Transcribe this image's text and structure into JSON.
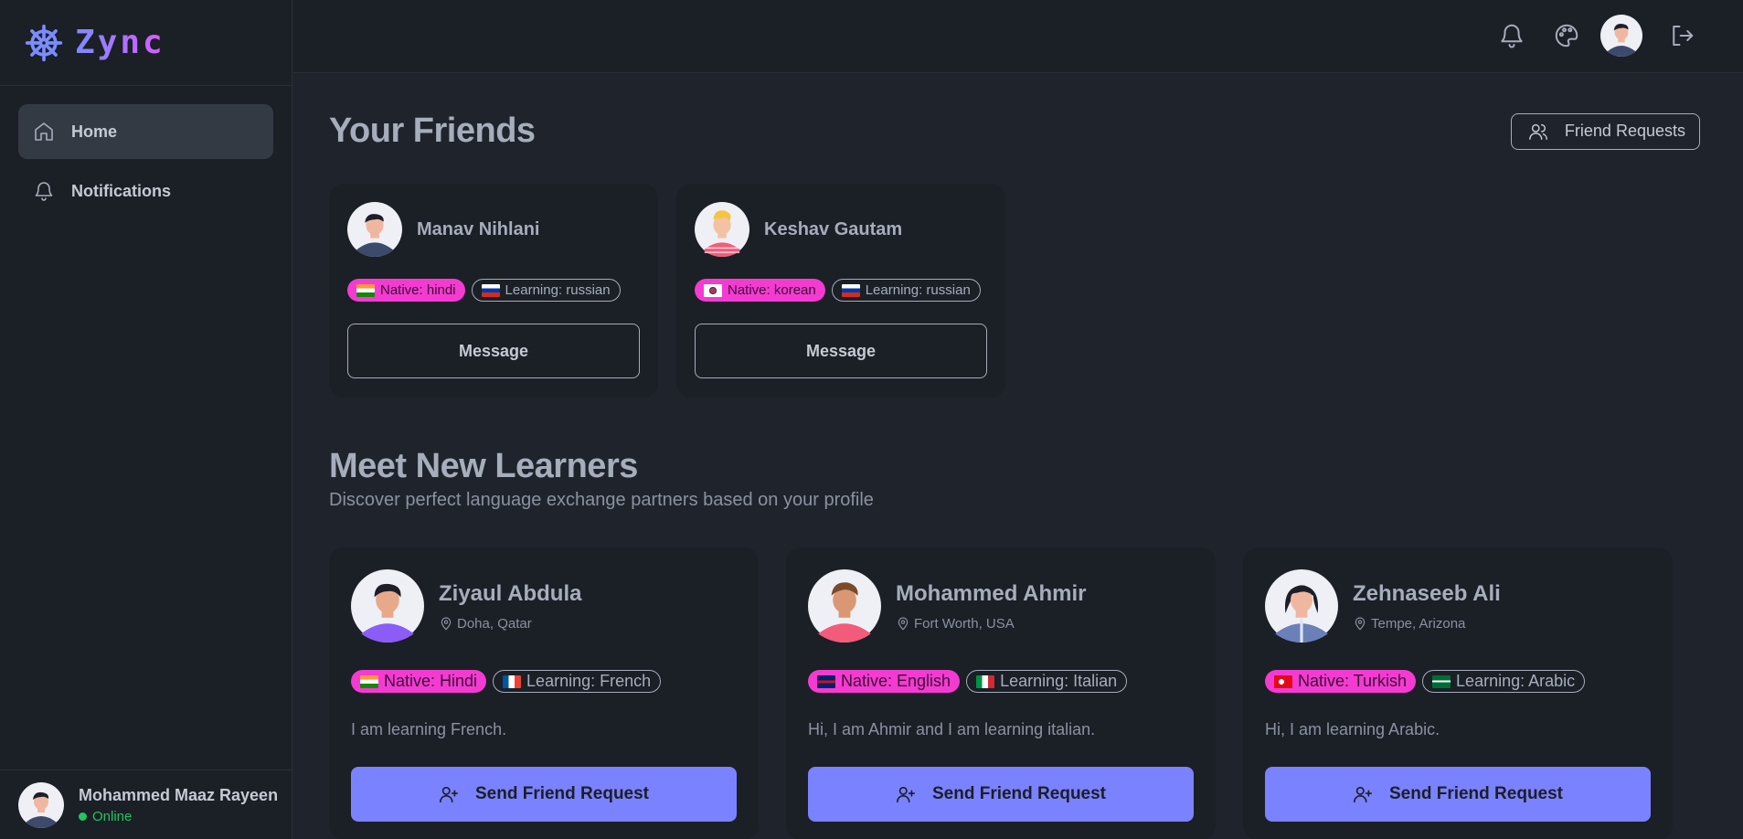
{
  "app": {
    "name": "Zync"
  },
  "sidebar": {
    "items": [
      {
        "label": "Home",
        "icon": "home-icon",
        "active": true
      },
      {
        "label": "Notifications",
        "icon": "bell-icon",
        "active": false
      }
    ],
    "user": {
      "name": "Mohammed Maaz Rayeen",
      "status": "Online"
    }
  },
  "topbar": {
    "icons": [
      "bell-icon",
      "palette-icon",
      "avatar",
      "logout-icon"
    ]
  },
  "friends_section": {
    "title": "Your Friends",
    "requests_label": "Friend Requests",
    "friends": [
      {
        "name": "Manav Nihlani",
        "native": "Native: hindi",
        "learning": "Learning: russian",
        "native_flag": "india",
        "learning_flag": "russia",
        "button": "Message"
      },
      {
        "name": "Keshav Gautam",
        "native": "Native: korean",
        "learning": "Learning: russian",
        "native_flag": "korea",
        "learning_flag": "russia",
        "button": "Message"
      }
    ]
  },
  "learners_section": {
    "title": "Meet New Learners",
    "subtitle": "Discover perfect language exchange partners based on your profile",
    "learners": [
      {
        "name": "Ziyaul Abdula",
        "location": "Doha, Qatar",
        "native": "Native: Hindi",
        "learning": "Learning: French",
        "native_flag": "india",
        "learning_flag": "france",
        "bio": "I am learning French.",
        "button": "Send Friend Request"
      },
      {
        "name": "Mohammed Ahmir",
        "location": "Fort Worth, USA",
        "native": "Native: English",
        "learning": "Learning: Italian",
        "native_flag": "uk",
        "learning_flag": "italy",
        "bio": "Hi, I am Ahmir and I am learning italian.",
        "button": "Send Friend Request"
      },
      {
        "name": "Zehnaseeb Ali",
        "location": "Tempe, Arizona",
        "native": "Native: Turkish",
        "learning": "Learning: Arabic",
        "native_flag": "turkey",
        "learning_flag": "saudi",
        "bio": "Hi, I am learning Arabic.",
        "button": "Send Friend Request"
      }
    ]
  },
  "colors": {
    "primary": "#7b82ff",
    "secondary": "#f43bd1",
    "success": "#22c55e",
    "background": "#1f242c",
    "surface": "#1b1f26"
  }
}
